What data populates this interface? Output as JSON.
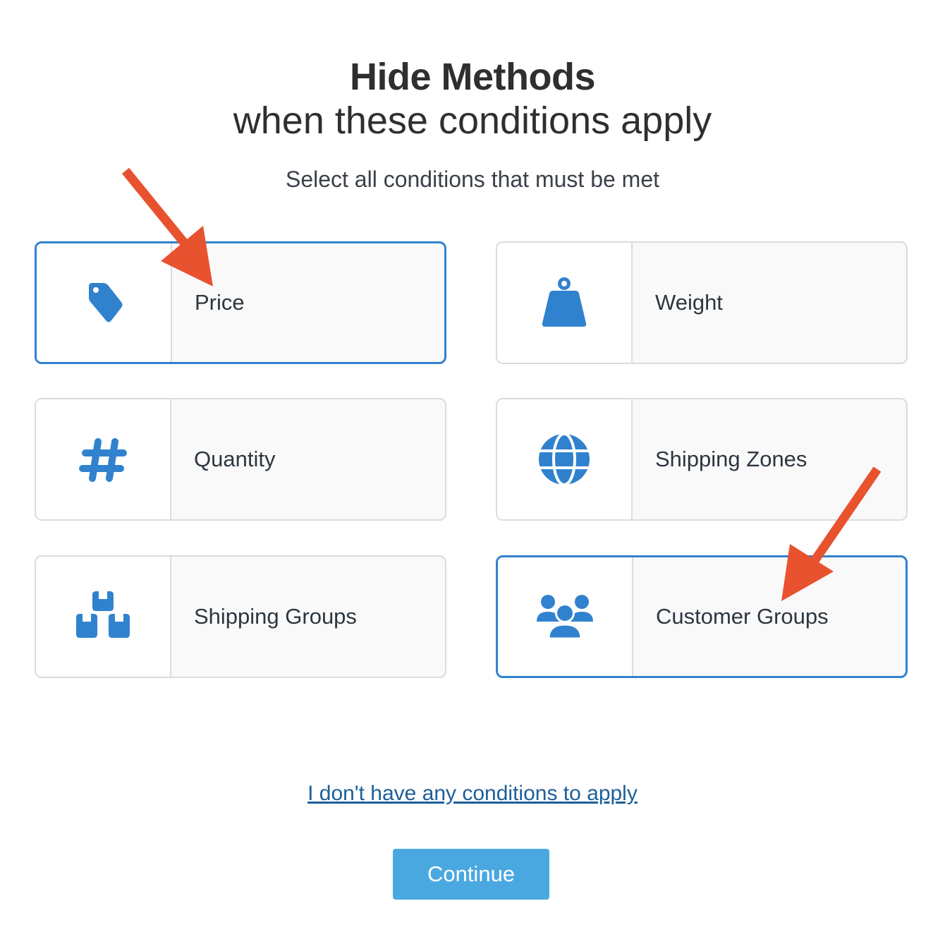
{
  "header": {
    "title": "Hide Methods",
    "subtitle": "when these conditions apply",
    "instruction": "Select all conditions that must be met"
  },
  "conditions": [
    {
      "label": "Price",
      "icon": "price-tag-icon",
      "selected": true
    },
    {
      "label": "Weight",
      "icon": "weight-icon",
      "selected": false
    },
    {
      "label": "Quantity",
      "icon": "hash-icon",
      "selected": false
    },
    {
      "label": "Shipping Zones",
      "icon": "globe-icon",
      "selected": false
    },
    {
      "label": "Shipping Groups",
      "icon": "boxes-icon",
      "selected": false
    },
    {
      "label": "Customer Groups",
      "icon": "users-icon",
      "selected": true
    }
  ],
  "footer": {
    "skip_link": "I don't have any conditions to apply",
    "continue_label": "Continue"
  },
  "colors": {
    "accent": "#3182ce",
    "button": "#4aa8e0",
    "annotation_arrow": "#e8522e"
  }
}
